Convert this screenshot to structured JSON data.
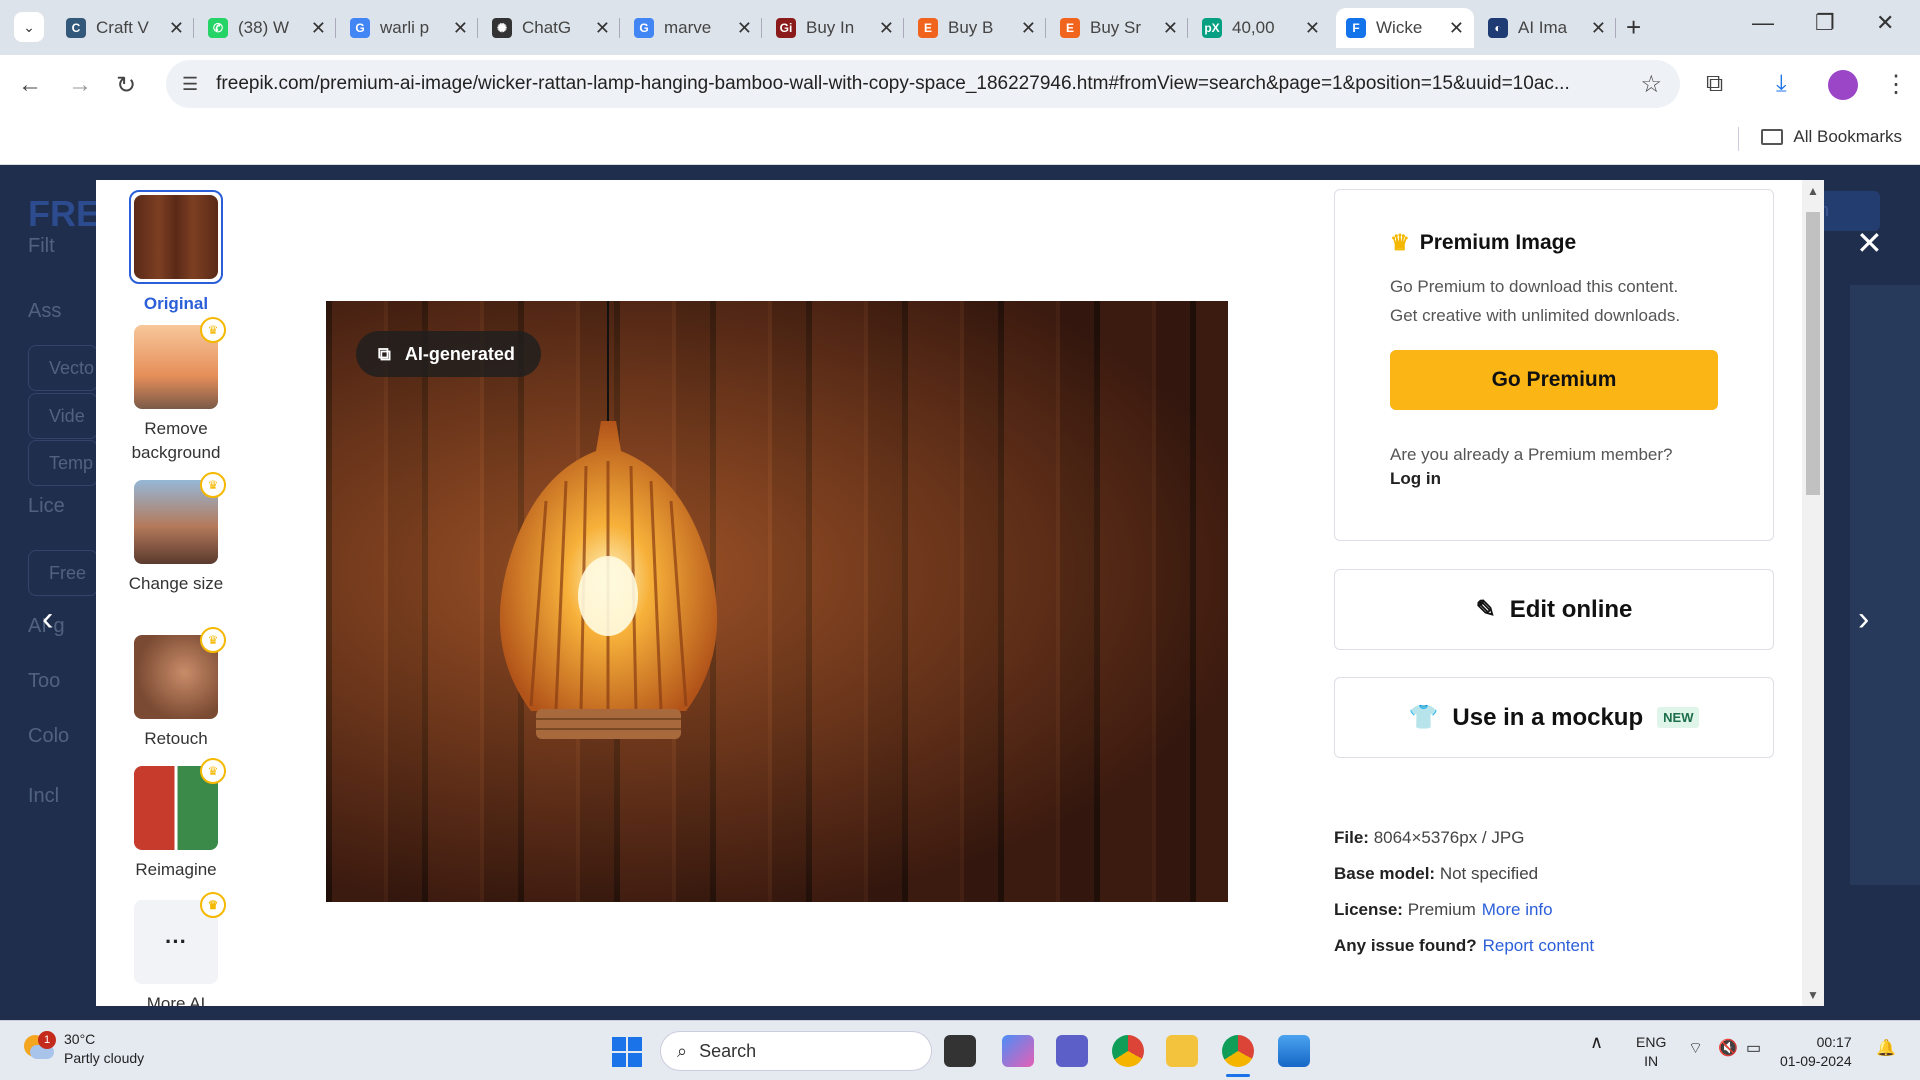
{
  "browser": {
    "tabs": [
      {
        "title": "Craft V",
        "favicon_color": "#33597a",
        "favicon_char": "C"
      },
      {
        "title": "(38) W",
        "favicon_color": "#25d366",
        "favicon_char": "✆"
      },
      {
        "title": "warli p",
        "favicon_color": "#4285f4",
        "favicon_char": "G"
      },
      {
        "title": "ChatG",
        "favicon_color": "#333333",
        "favicon_char": "✺"
      },
      {
        "title": "marve",
        "favicon_color": "#4285f4",
        "favicon_char": "G"
      },
      {
        "title": "Buy In",
        "favicon_color": "#8b1a1a",
        "favicon_char": "Gi"
      },
      {
        "title": "Buy B",
        "favicon_color": "#f1641e",
        "favicon_char": "E"
      },
      {
        "title": "Buy Sr",
        "favicon_color": "#f1641e",
        "favicon_char": "E"
      },
      {
        "title": "40,00",
        "favicon_color": "#05a081",
        "favicon_char": "pX"
      },
      {
        "title": "Wicke",
        "favicon_color": "#1273eb",
        "favicon_char": "F"
      },
      {
        "title": "AI Ima",
        "favicon_color": "#1f3b73",
        "favicon_char": "◐"
      }
    ],
    "url": "freepik.com/premium-ai-image/wicker-rattan-lamp-hanging-bamboo-wall-with-copy-space_186227946.htm#fromView=search&page=1&position=15&uuid=10ac...",
    "bookmarks_label": "All Bookmarks"
  },
  "background": {
    "logo": "FRE",
    "menu_items": [
      "Filt",
      "Ass",
      "Vecto",
      "Vide",
      "Temp",
      "Lice",
      "Free",
      "AI-g",
      "Too",
      "Colo",
      "Incl"
    ],
    "search_btn": "arch"
  },
  "modal": {
    "tools": [
      {
        "label": "Original",
        "icon": "lamp-thumbnail",
        "premium": false
      },
      {
        "label": "Remove background",
        "icon": "balloon-thumbnail",
        "premium": true
      },
      {
        "label": "Change size",
        "icon": "canyon-thumbnail",
        "premium": true
      },
      {
        "label": "Retouch",
        "icon": "face-thumbnail",
        "premium": true
      },
      {
        "label": "Reimagine",
        "icon": "parrot-thumbnail",
        "premium": true
      },
      {
        "label": "More AI",
        "icon": "more-dots",
        "premium": true
      }
    ],
    "more_glyph": "···",
    "ai_badge": "AI-generated",
    "premium": {
      "title": "Premium Image",
      "line1": "Go Premium to download this content.",
      "line2": "Get creative with unlimited downloads.",
      "button": "Go Premium",
      "already": "Are you already a Premium member?",
      "login": "Log in",
      "accent": "#fbb616"
    },
    "edit_online": "Edit online",
    "mockup": {
      "label": "Use in a mockup",
      "badge": "NEW"
    },
    "meta": {
      "file_label": "File:",
      "file_value": "8064×5376px / JPG",
      "model_label": "Base model:",
      "model_value": "Not specified",
      "license_label": "License:",
      "license_value": "Premium",
      "license_link": "More info",
      "issue_label": "Any issue found?",
      "issue_link": "Report content"
    }
  },
  "taskbar": {
    "weather_temp": "30°C",
    "weather_desc": "Partly cloudy",
    "weather_badge": "1",
    "search_placeholder": "Search",
    "lang_top": "ENG",
    "lang_bottom": "IN",
    "time": "00:17",
    "date": "01-09-2024"
  }
}
